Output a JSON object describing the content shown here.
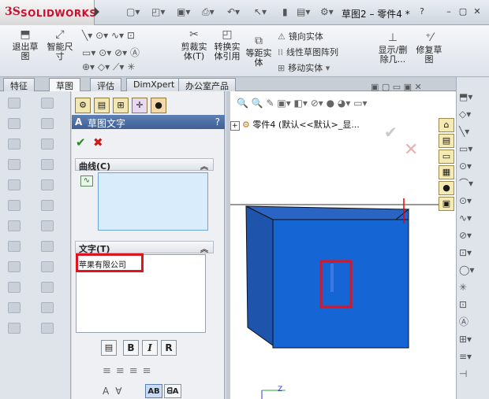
{
  "app": {
    "brand_prefix": "3S",
    "brand": "SOLIDWORKS"
  },
  "titlebar": {
    "document_title": "草图2 – 零件4 *",
    "help_label": "?",
    "min_label": "–",
    "max_label": "▢",
    "close_label": "✕"
  },
  "ribbon": {
    "exit_sketch": "退出草\n图",
    "smart_dim": "智能尺\n寸",
    "trim": "剪裁实\n体(T)",
    "convert": "转换实\n体引用",
    "offset": "等距实\n体",
    "mirror": "镜向实体",
    "linear_pattern": "线性草图阵列",
    "move": "移动实体",
    "show_delete": "显示/删\n除几...",
    "repair": "修复草\n图"
  },
  "tabs": [
    {
      "label": "特征"
    },
    {
      "label": "草图"
    },
    {
      "label": "评估"
    },
    {
      "label": "DimXpert"
    },
    {
      "label": "办公室产品"
    }
  ],
  "property_manager": {
    "title": "草图文字",
    "help": "?",
    "ok": "✔",
    "cancel": "✖",
    "curves_section": "曲线(C)",
    "text_section": "文字(T)",
    "text_value": "苹果有限公司",
    "bold": "B",
    "italic": "I",
    "rotate": "R"
  },
  "graphics": {
    "tree_root": "零件4  (默认<<默认>_显...",
    "plus": "+"
  },
  "triad": {
    "z": "Z"
  }
}
